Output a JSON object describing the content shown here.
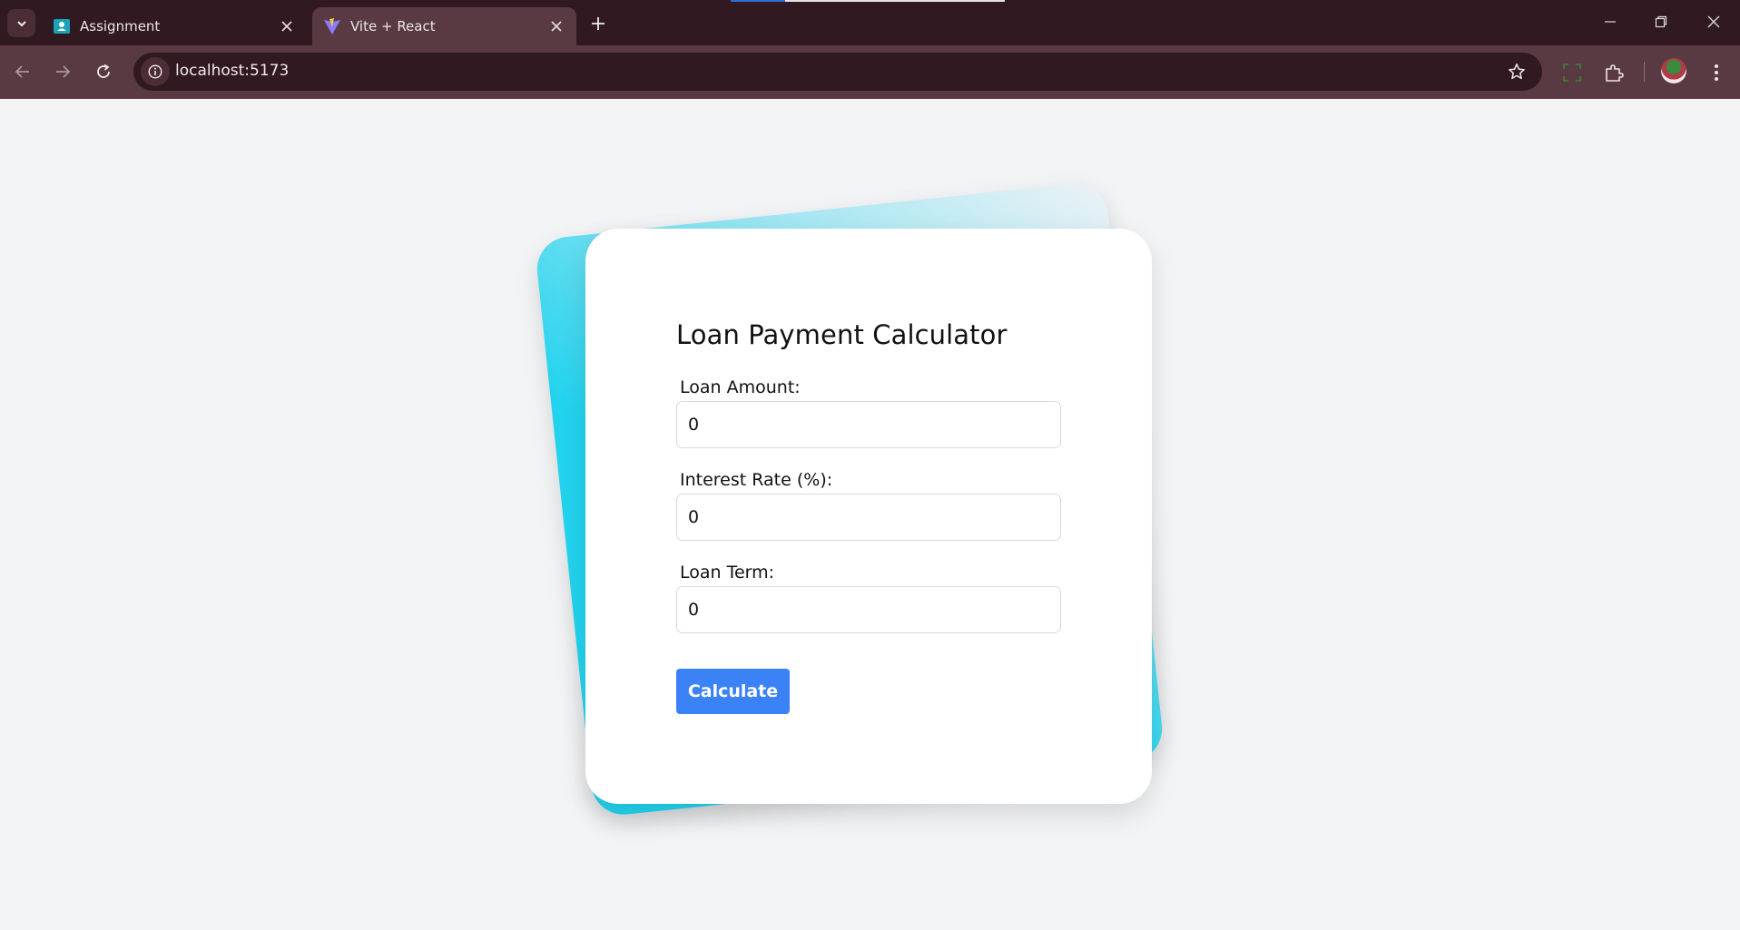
{
  "browser": {
    "tabs": [
      {
        "title": "Assignment",
        "favicon": "classroom-icon",
        "active": false
      },
      {
        "title": "Vite + React",
        "favicon": "vite-icon",
        "active": true
      }
    ],
    "address": "localhost:5173"
  },
  "calculator": {
    "title": "Loan Payment Calculator",
    "fields": [
      {
        "label": "Loan Amount:",
        "value": "0"
      },
      {
        "label": "Interest Rate (%):",
        "value": "0"
      },
      {
        "label": "Loan Term:",
        "value": "0"
      }
    ],
    "button_label": "Calculate"
  },
  "colors": {
    "accent": "#3b82f6",
    "decor": "#22d3ee",
    "page_bg": "#f3f4f6",
    "chrome_dark": "#301920",
    "chrome_toolbar": "#5a3a42"
  }
}
